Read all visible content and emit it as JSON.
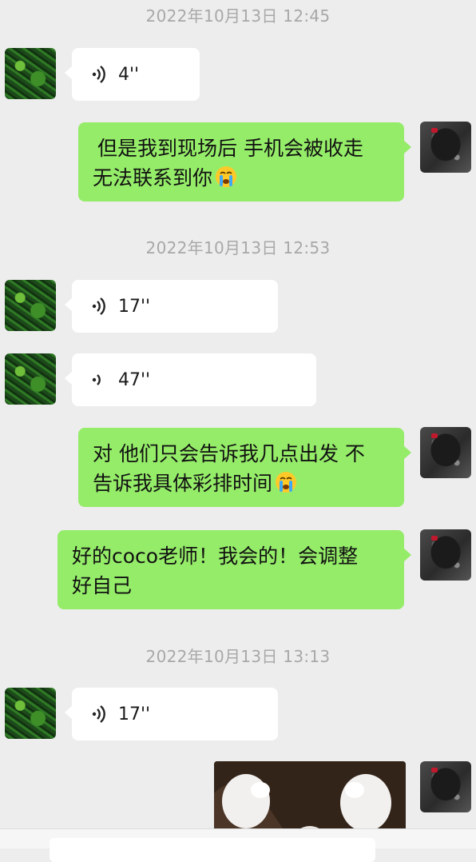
{
  "colors": {
    "background": "#ededed",
    "sent_bubble": "#95ec69",
    "received_bubble": "#ffffff",
    "timestamp": "#a8a8a8"
  },
  "timestamps": [
    "2022年10月13日 12:45",
    "2022年10月13日 12:53",
    "2022年10月13日 13:13"
  ],
  "messages": [
    {
      "sender": "other",
      "type": "voice",
      "duration": "4''"
    },
    {
      "sender": "self",
      "type": "text",
      "lines": [
        "但是我到现场后 手机会被收走",
        "无法联系到你"
      ],
      "emoji": "crying-face"
    },
    {
      "sender": "other",
      "type": "voice",
      "duration": "17''"
    },
    {
      "sender": "other",
      "type": "voice",
      "duration": "47''"
    },
    {
      "sender": "self",
      "type": "text",
      "lines": [
        "对 他们只会告诉我几点出发 不",
        "告诉我具体彩排时间"
      ],
      "emoji": "crying-face"
    },
    {
      "sender": "self",
      "type": "text",
      "lines": [
        "好的coco老师！我会的！会调整",
        "好自己"
      ]
    },
    {
      "sender": "other",
      "type": "voice",
      "duration": "17''"
    },
    {
      "sender": "self",
      "type": "image",
      "image": "cat-paws-photo"
    }
  ]
}
